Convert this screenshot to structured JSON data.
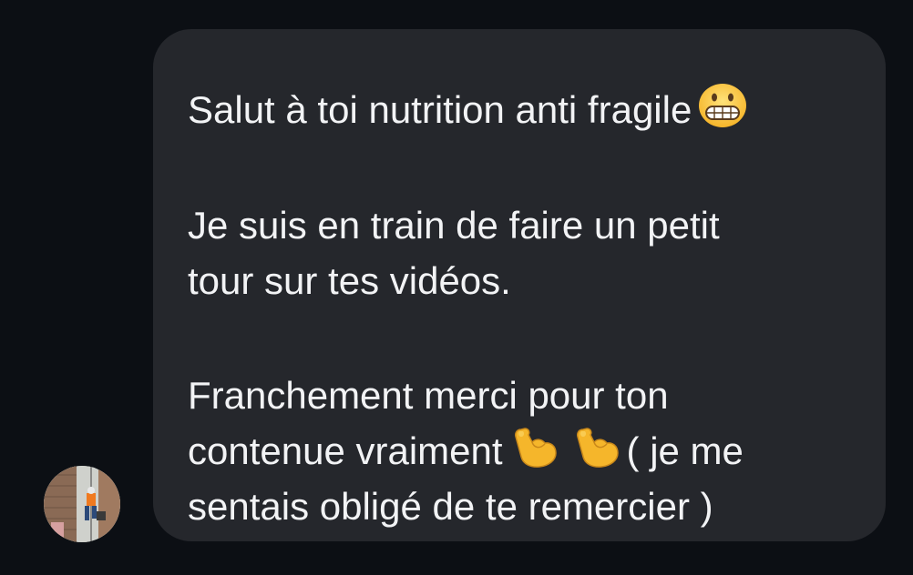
{
  "message": {
    "line1_text": "Salut à toi nutrition anti fragile",
    "line1_emoji": "grimacing-face-emoji",
    "para2_line1": "Je suis en train de faire un petit",
    "para2_line2": "tour sur tes vidéos.",
    "para3_line1": "Franchement merci pour ton",
    "para3_line2_start": "contenue vraiment",
    "para3_line2_emojis": [
      "flexed-biceps-emoji",
      "flexed-biceps-emoji"
    ],
    "para3_line2_end": "( je me",
    "para3_line3": "sentais obligé de te remercier )"
  },
  "sender": {
    "avatar": "profile-photo"
  },
  "colors": {
    "background": "#0c0f14",
    "bubble": "#25272c",
    "text": "#f2f3f5"
  }
}
